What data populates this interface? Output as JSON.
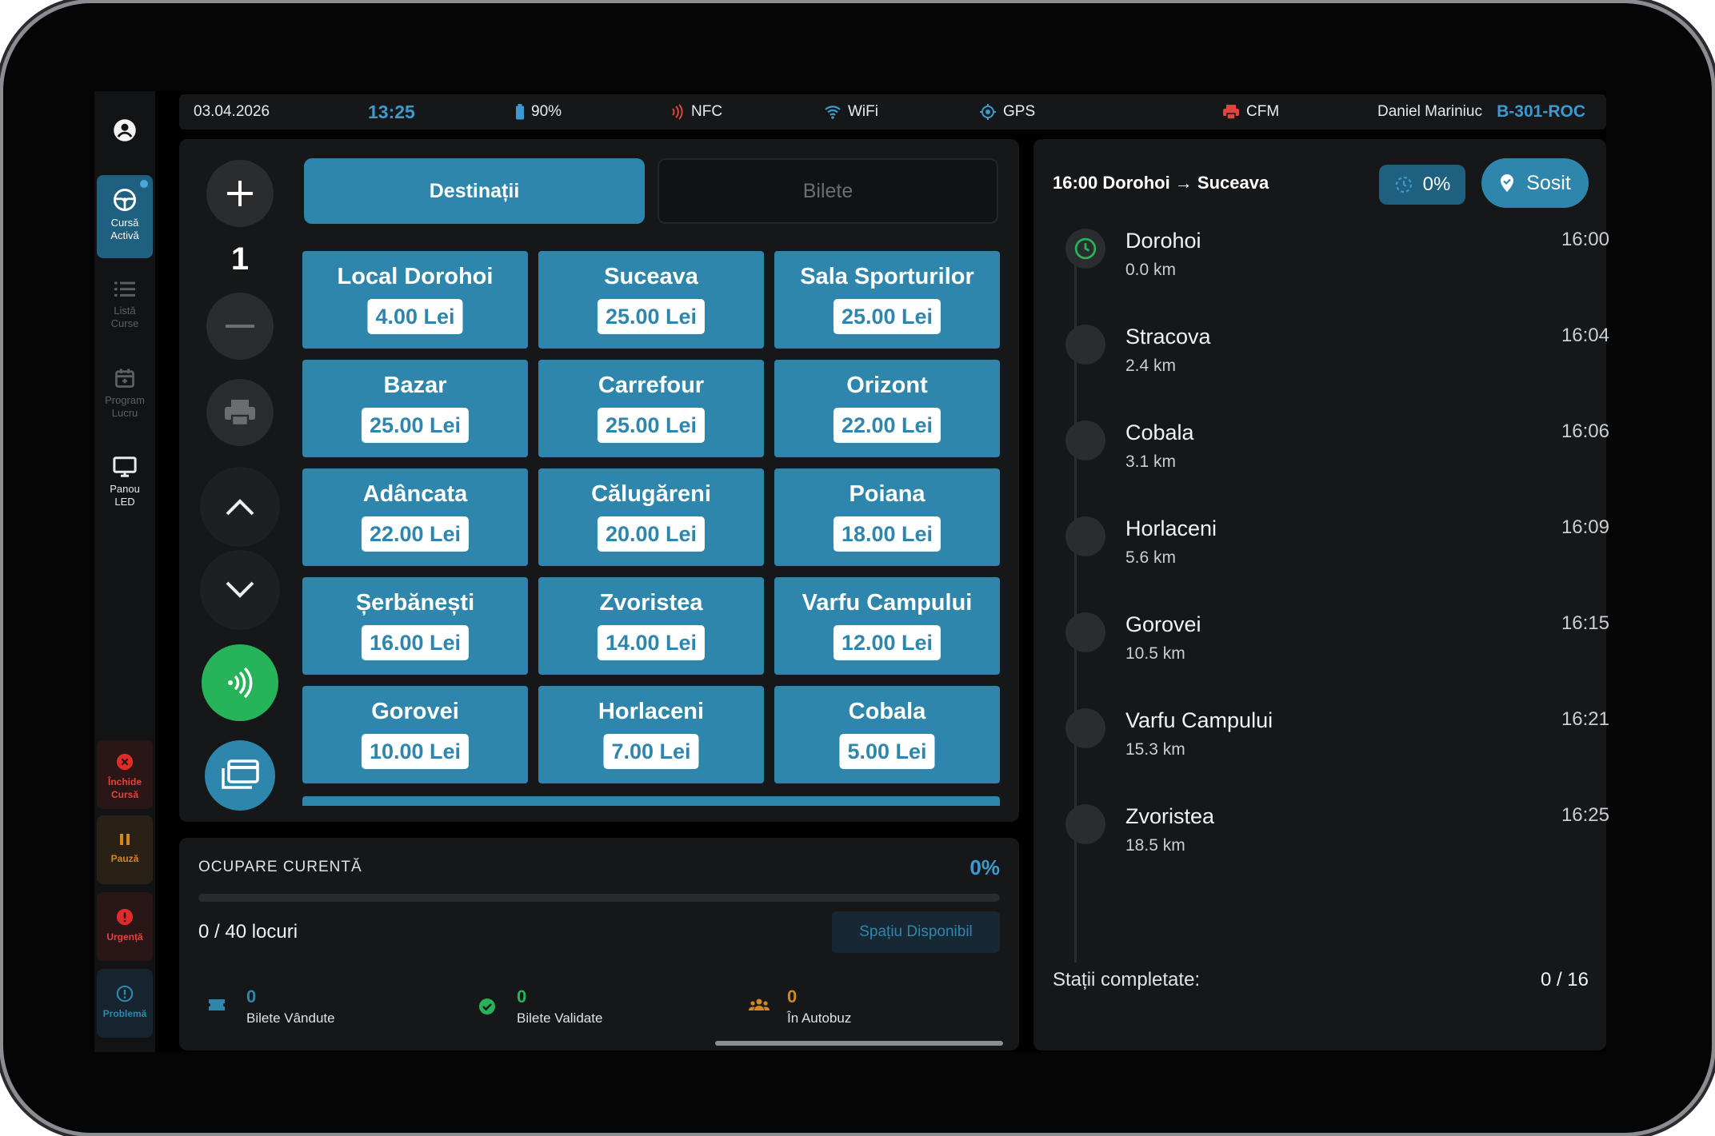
{
  "status_bar": {
    "date": "03.04.2026",
    "time": "13:25",
    "battery": "90%",
    "nfc": "NFC",
    "wifi": "WiFi",
    "gps": "GPS",
    "cfm": "CFM",
    "driver": "Daniel Mariniuc",
    "vehicle": "B-301-ROC"
  },
  "sidebar": {
    "items": [
      {
        "label": "Cursă\nActivă"
      },
      {
        "label": "Listă\nCurse"
      },
      {
        "label": "Program\nLucru"
      },
      {
        "label": "Panou\nLED"
      }
    ],
    "actions": [
      {
        "label": "Închide\nCursă"
      },
      {
        "label": "Pauză"
      },
      {
        "label": "Urgență"
      },
      {
        "label": "Problemă"
      }
    ]
  },
  "controls": {
    "quantity": "1"
  },
  "tabs": [
    {
      "label": "Destinații"
    },
    {
      "label": "Bilete"
    }
  ],
  "destinations": [
    {
      "name": "Local Dorohoi",
      "price": "4.00 Lei"
    },
    {
      "name": "Suceava",
      "price": "25.00 Lei"
    },
    {
      "name": "Sala Sporturilor",
      "price": "25.00 Lei"
    },
    {
      "name": "Bazar",
      "price": "25.00 Lei"
    },
    {
      "name": "Carrefour",
      "price": "25.00 Lei"
    },
    {
      "name": "Orizont",
      "price": "22.00 Lei"
    },
    {
      "name": "Adâncata",
      "price": "22.00 Lei"
    },
    {
      "name": "Călugăreni",
      "price": "20.00 Lei"
    },
    {
      "name": "Poiana",
      "price": "18.00 Lei"
    },
    {
      "name": "Șerbănești",
      "price": "16.00 Lei"
    },
    {
      "name": "Zvoristea",
      "price": "14.00 Lei"
    },
    {
      "name": "Varfu Campului",
      "price": "12.00 Lei"
    },
    {
      "name": "Gorovei",
      "price": "10.00 Lei"
    },
    {
      "name": "Horlaceni",
      "price": "7.00 Lei"
    },
    {
      "name": "Cobala",
      "price": "5.00 Lei"
    }
  ],
  "occupancy": {
    "title": "OCUPARE CURENTĂ",
    "percent": "0%",
    "progress": 0,
    "seats": "0 / 40 locuri",
    "status": "Spațiu Disponibil",
    "stats": [
      {
        "value": "0",
        "label": "Bilete Vândute"
      },
      {
        "value": "0",
        "label": "Bilete Validate"
      },
      {
        "value": "0",
        "label": "În Autobuz"
      }
    ]
  },
  "route": {
    "title": "16:00 Dorohoi → Suceava",
    "progress": "0%",
    "arrived_label": "Sosit",
    "stops": [
      {
        "name": "Dorohoi",
        "km": "0.0 km",
        "time": "16:00"
      },
      {
        "name": "Stracova",
        "km": "2.4 km",
        "time": "16:04"
      },
      {
        "name": "Cobala",
        "km": "3.1 km",
        "time": "16:06"
      },
      {
        "name": "Horlaceni",
        "km": "5.6 km",
        "time": "16:09"
      },
      {
        "name": "Gorovei",
        "km": "10.5 km",
        "time": "16:15"
      },
      {
        "name": "Varfu Campului",
        "km": "15.3 km",
        "time": "16:21"
      },
      {
        "name": "Zvoristea",
        "km": "18.5 km",
        "time": "16:25"
      }
    ],
    "completed_label": "Stații completate:",
    "completed_value": "0 / 16"
  },
  "colors": {
    "accent": "#2f86ad",
    "nfc_red": "#e0443a",
    "green": "#27b35a",
    "orange": "#d4881c",
    "danger": "#e02b2b"
  }
}
